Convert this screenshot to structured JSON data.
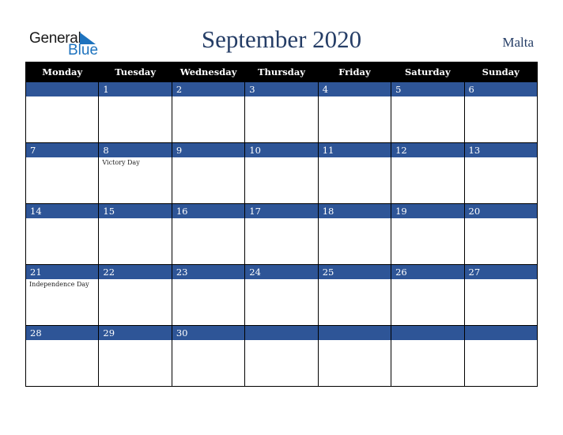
{
  "logo": {
    "line1": "General",
    "line2": "Blue",
    "icon": "triangle-flag-icon",
    "color": "#1e73be"
  },
  "title": "September 2020",
  "country": "Malta",
  "colors": {
    "header_bg": "#000000",
    "date_bar": "#2e5597",
    "title": "#253d66"
  },
  "weekdays": [
    "Monday",
    "Tuesday",
    "Wednesday",
    "Thursday",
    "Friday",
    "Saturday",
    "Sunday"
  ],
  "weeks": [
    [
      {
        "day": ""
      },
      {
        "day": "1"
      },
      {
        "day": "2"
      },
      {
        "day": "3"
      },
      {
        "day": "4"
      },
      {
        "day": "5"
      },
      {
        "day": "6"
      }
    ],
    [
      {
        "day": "7"
      },
      {
        "day": "8",
        "holiday": "Victory Day"
      },
      {
        "day": "9"
      },
      {
        "day": "10"
      },
      {
        "day": "11"
      },
      {
        "day": "12"
      },
      {
        "day": "13"
      }
    ],
    [
      {
        "day": "14"
      },
      {
        "day": "15"
      },
      {
        "day": "16"
      },
      {
        "day": "17"
      },
      {
        "day": "18"
      },
      {
        "day": "19"
      },
      {
        "day": "20"
      }
    ],
    [
      {
        "day": "21",
        "holiday": "Independence Day"
      },
      {
        "day": "22"
      },
      {
        "day": "23"
      },
      {
        "day": "24"
      },
      {
        "day": "25"
      },
      {
        "day": "26"
      },
      {
        "day": "27"
      }
    ],
    [
      {
        "day": "28"
      },
      {
        "day": "29"
      },
      {
        "day": "30"
      },
      {
        "day": ""
      },
      {
        "day": ""
      },
      {
        "day": ""
      },
      {
        "day": ""
      }
    ]
  ]
}
